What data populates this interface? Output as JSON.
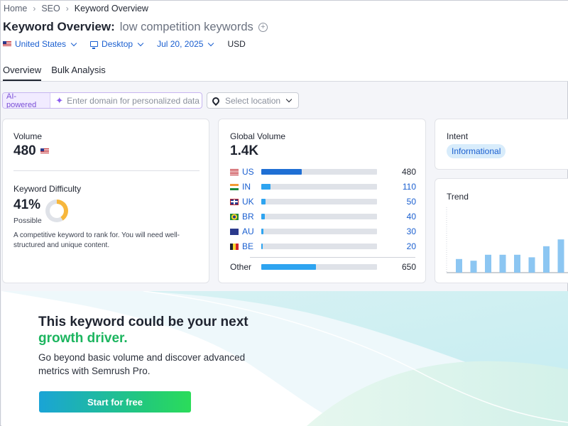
{
  "breadcrumb": [
    "Home",
    "SEO",
    "Keyword Overview"
  ],
  "header": {
    "title": "Keyword Overview:",
    "keyword": "low competition keywords",
    "filters": {
      "country": "United States",
      "device": "Desktop",
      "date": "Jul 20, 2025",
      "currency": "USD"
    },
    "tabs": [
      "Overview",
      "Bulk Analysis"
    ]
  },
  "ai": {
    "badge": "AI-powered",
    "placeholder": "Enter domain for personalized data",
    "location_placeholder": "Select location"
  },
  "volume": {
    "label": "Volume",
    "value": "480"
  },
  "difficulty": {
    "label": "Keyword Difficulty",
    "value": "41%",
    "level": "Possible",
    "percent": 41,
    "description": "A competitive keyword to rank for. You will need well-structured and unique content."
  },
  "global_volume": {
    "label": "Global Volume",
    "value": "1.4K",
    "rows": [
      {
        "code": "US",
        "value": "480",
        "fraction": 0.35
      },
      {
        "code": "IN",
        "value": "110",
        "fraction": 0.08
      },
      {
        "code": "UK",
        "value": "50",
        "fraction": 0.035
      },
      {
        "code": "BR",
        "value": "40",
        "fraction": 0.03
      },
      {
        "code": "AU",
        "value": "30",
        "fraction": 0.02
      },
      {
        "code": "BE",
        "value": "20",
        "fraction": 0.015
      }
    ],
    "other": {
      "label": "Other",
      "value": "650",
      "fraction": 0.47
    }
  },
  "intent": {
    "label": "Intent",
    "badge": "Informational"
  },
  "trend": {
    "label": "Trend",
    "bars": [
      0.32,
      0.28,
      0.42,
      0.42,
      0.42,
      0.36,
      0.62,
      0.78
    ]
  },
  "promo": {
    "headline": "This keyword could be your next",
    "highlight": "growth driver.",
    "body": "Go beyond basic volume and discover advanced metrics with Semrush Pro.",
    "cta": "Start for free"
  },
  "colors": {
    "link": "#1a5fd0",
    "bar_primary": "#1f6fd4",
    "bar_secondary": "#2ea4f0",
    "accent_green": "#1cb55f",
    "donut": "#f7b73c"
  }
}
